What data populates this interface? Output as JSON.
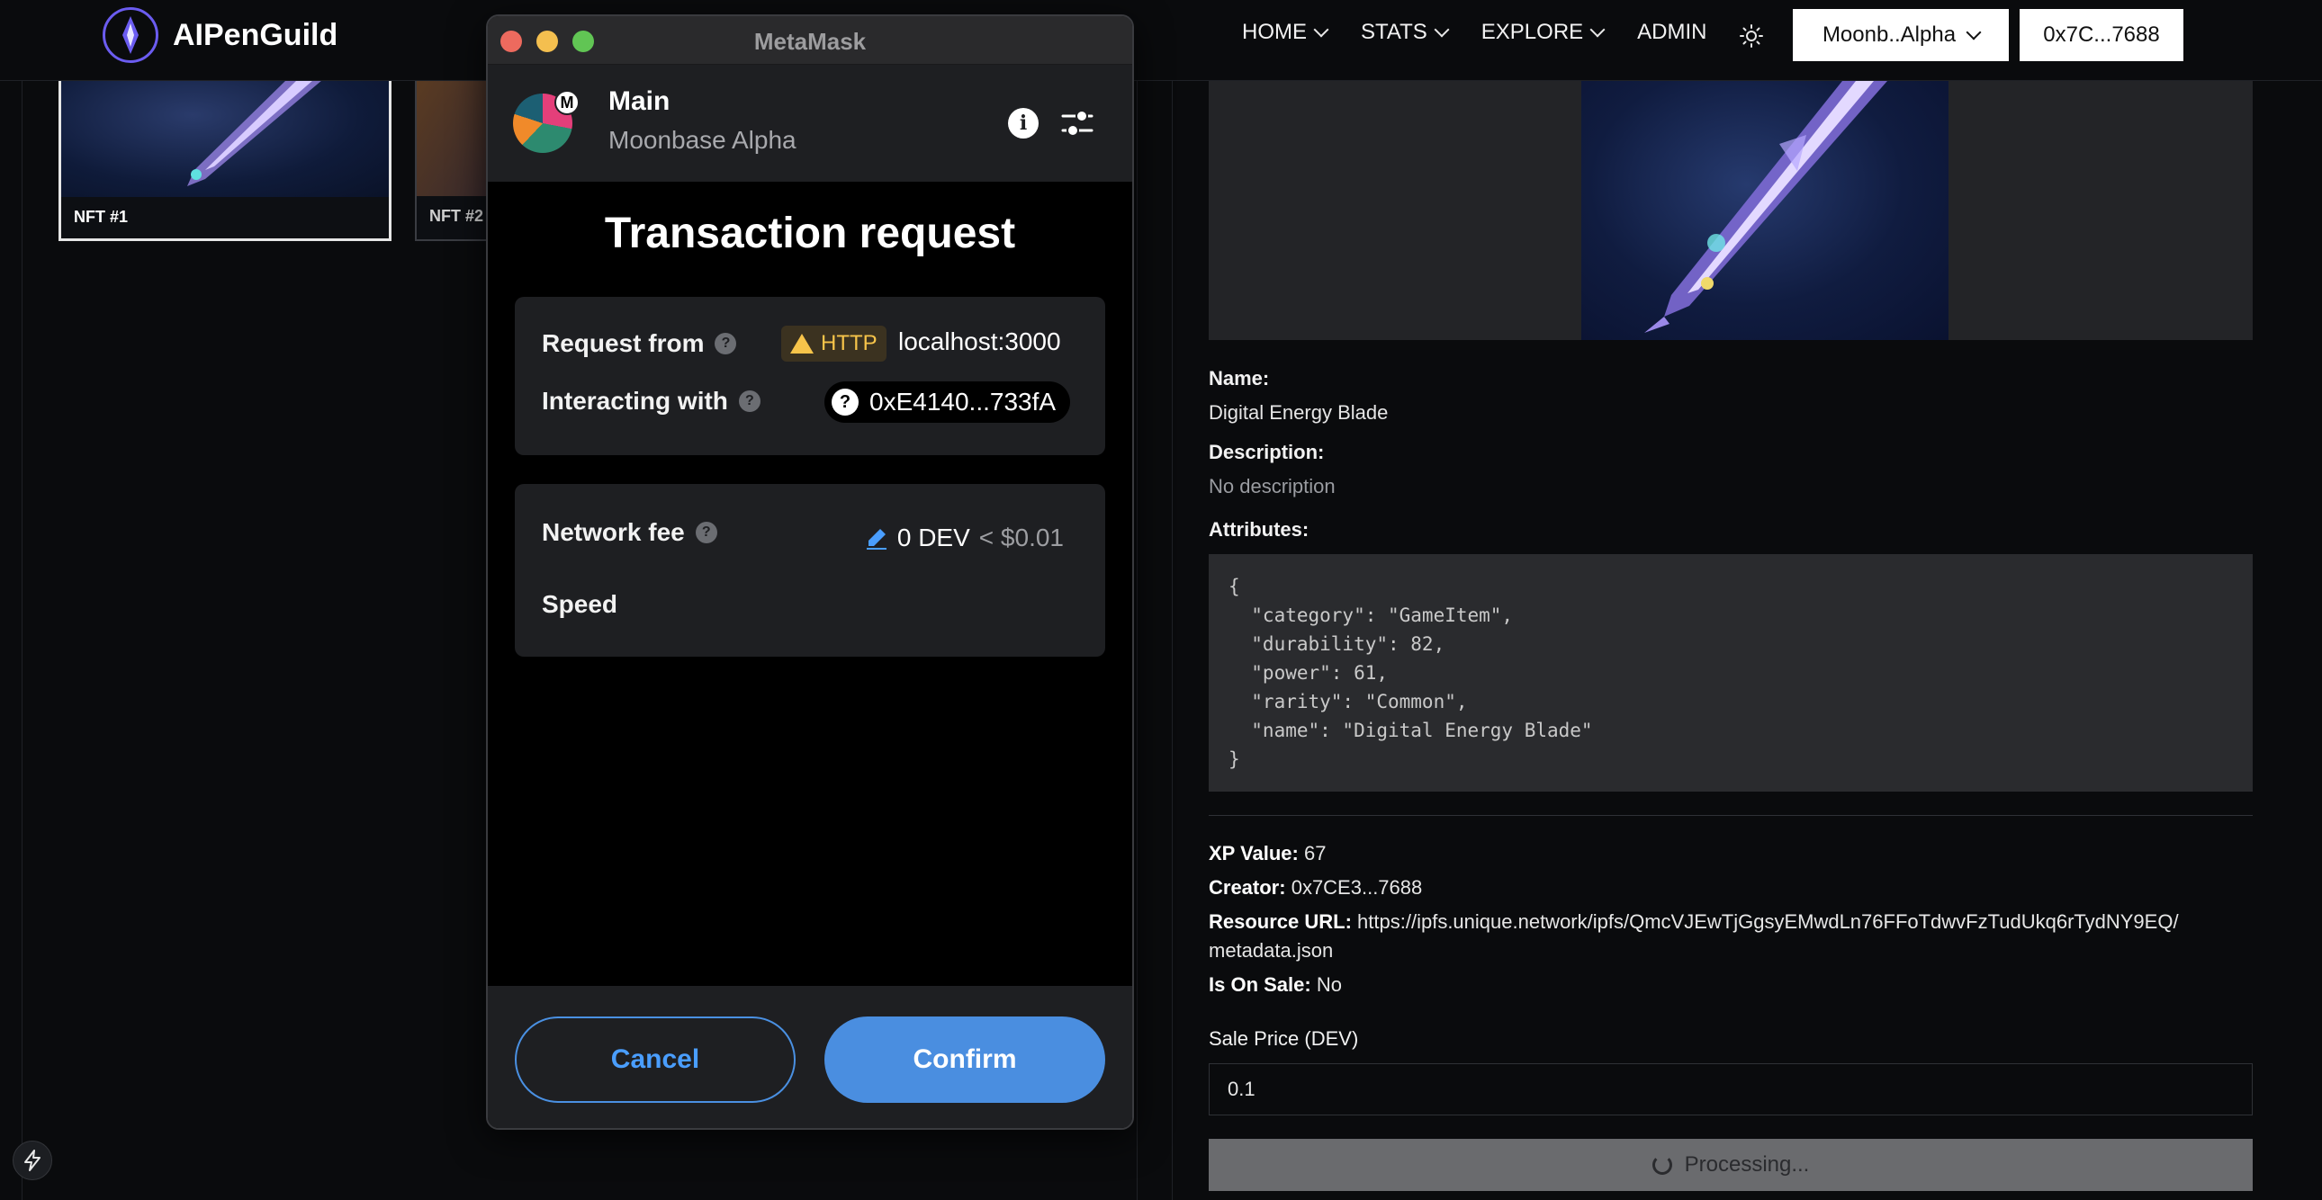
{
  "app": {
    "brand_name": "AIPenGuild",
    "nav": [
      "HOME",
      "STATS",
      "EXPLORE",
      "ADMIN"
    ],
    "network_button": "Moonb..Alpha",
    "account_button": "0x7C...7688"
  },
  "gallery": {
    "cards": [
      {
        "label": "NFT #1"
      },
      {
        "label": "NFT #2"
      }
    ]
  },
  "detail": {
    "name_label": "Name:",
    "name_value": "Digital Energy Blade",
    "description_label": "Description:",
    "description_value": "No description",
    "attributes_label": "Attributes:",
    "attributes_json": "{\n  \"category\": \"GameItem\",\n  \"durability\": 82,\n  \"power\": 61,\n  \"rarity\": \"Common\",\n  \"name\": \"Digital Energy Blade\"\n}",
    "xp_label": "XP Value:",
    "xp_value": "67",
    "creator_label": "Creator:",
    "creator_value": "0x7CE3...7688",
    "resource_label": "Resource URL:",
    "resource_value_line1": "https://ipfs.unique.network/ipfs/QmcVJEwTjGgsyEMwdLn76FFoTdwvFzTudUkq6rTydNY9EQ/",
    "resource_value_line2": "metadata.json",
    "onsale_label": "Is On Sale:",
    "onsale_value": "No",
    "sale_price_label": "Sale Price (DEV)",
    "sale_price_value": "0.1",
    "processing_label": "Processing..."
  },
  "metamask": {
    "window_title": "MetaMask",
    "account_name": "Main",
    "network_name": "Moonbase Alpha",
    "avatar_badge": "M",
    "heading": "Transaction request",
    "request_from_label": "Request from",
    "http_badge": "HTTP",
    "origin": "localhost:3000",
    "interacting_label": "Interacting with",
    "contract_address": "0xE4140...733fA",
    "network_fee_label": "Network fee",
    "fee_amount": "0 DEV",
    "fee_fiat": "< $0.01",
    "speed_label": "Speed",
    "cancel_label": "Cancel",
    "confirm_label": "Confirm"
  },
  "colors": {
    "accent_blue": "#4a8ee0",
    "logo_purple": "#6b5cf0",
    "warning_yellow": "#f7c44a",
    "background": "#0a0b0d"
  }
}
